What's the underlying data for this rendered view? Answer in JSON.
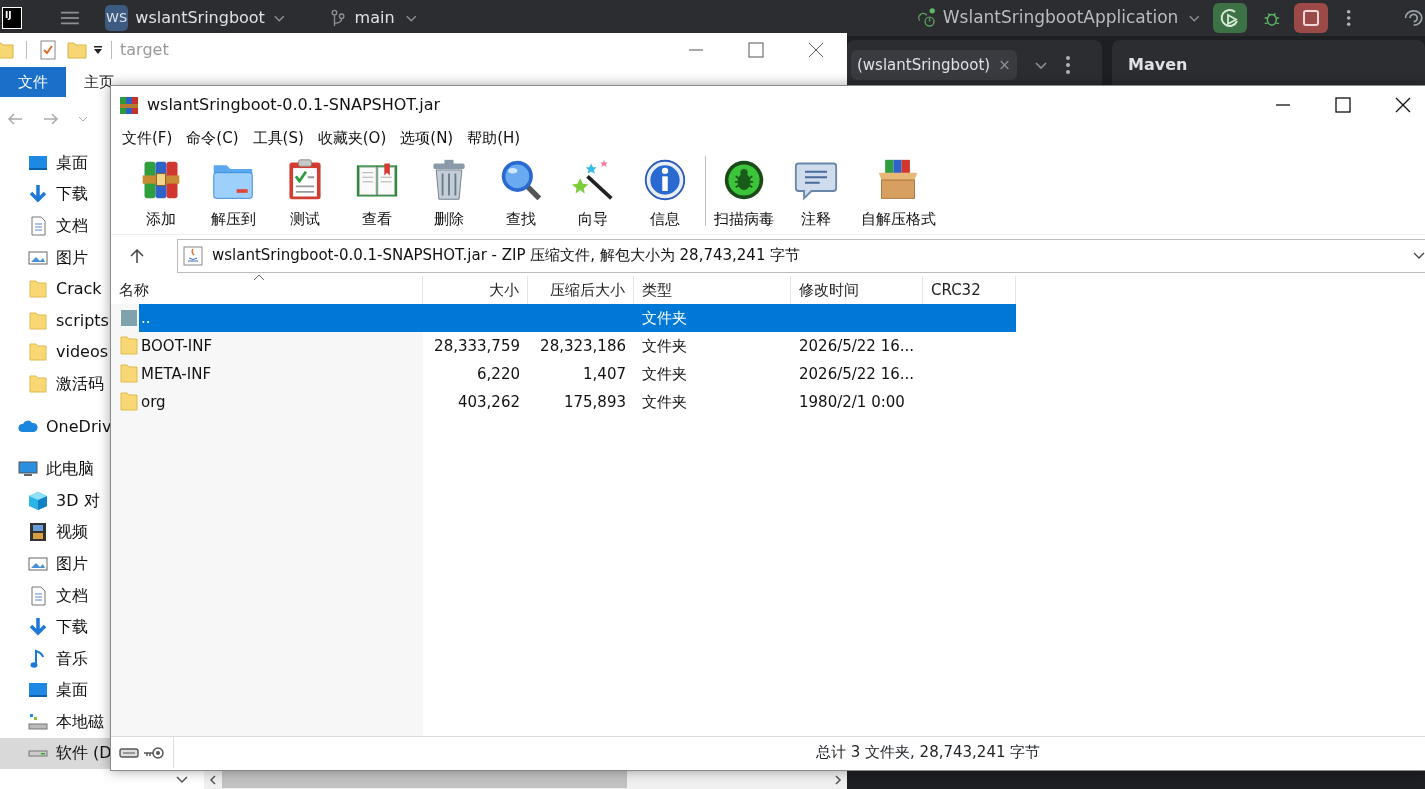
{
  "ide": {
    "logo": "IJ",
    "project_badge": "WS",
    "project": "wslantSringboot",
    "branch": "main",
    "run_config": "WslantSringbootApplication",
    "tab": {
      "label": "(wslantSringboot)",
      "close": "×"
    },
    "panel_title": "Maven"
  },
  "explorer": {
    "title": "target",
    "ribbon_tabs": [
      {
        "label": "文件",
        "selected": true
      },
      {
        "label": "主页",
        "selected": false
      }
    ],
    "quick_access": [
      {
        "label": "桌面",
        "selected": false
      },
      {
        "label": "下载",
        "selected": false
      },
      {
        "label": "文档",
        "selected": false
      },
      {
        "label": "图片",
        "selected": false
      },
      {
        "label": "Crack",
        "selected": false
      },
      {
        "label": "scripts",
        "selected": false
      },
      {
        "label": "videos",
        "selected": false
      },
      {
        "label": "激活码",
        "selected": false
      }
    ],
    "roots": [
      {
        "label": "OneDriv",
        "selected": false
      },
      {
        "label": "此电脑",
        "selected": false,
        "children": [
          {
            "label": "3D 对",
            "selected": false
          },
          {
            "label": "视频",
            "selected": false
          },
          {
            "label": "图片",
            "selected": false
          },
          {
            "label": "文档",
            "selected": false
          },
          {
            "label": "下载",
            "selected": false
          },
          {
            "label": "音乐",
            "selected": false
          },
          {
            "label": "桌面",
            "selected": false
          },
          {
            "label": "本地磁",
            "selected": false
          },
          {
            "label": "软件 (D",
            "selected": true
          }
        ]
      }
    ]
  },
  "winrar": {
    "title": "wslantSringboot-0.0.1-SNAPSHOT.jar",
    "menu": [
      "文件(F)",
      "命令(C)",
      "工具(S)",
      "收藏夹(O)",
      "选项(N)",
      "帮助(H)"
    ],
    "toolbar": [
      {
        "label": "添加"
      },
      {
        "label": "解压到"
      },
      {
        "label": "测试"
      },
      {
        "label": "查看"
      },
      {
        "label": "删除"
      },
      {
        "label": "查找"
      },
      {
        "label": "向导"
      },
      {
        "label": "信息"
      },
      {
        "label": "扫描病毒",
        "separated": true
      },
      {
        "label": "注释"
      },
      {
        "label": "自解压格式"
      }
    ],
    "address": "wslantSringboot-0.0.1-SNAPSHOT.jar - ZIP 压缩文件, 解包大小为 28,743,241 字节",
    "columns": [
      "名称",
      "大小",
      "压缩后大小",
      "类型",
      "修改时间",
      "CRC32"
    ],
    "rows": [
      {
        "kind": "parent",
        "name": "..",
        "type": "文件夹",
        "selected": true
      },
      {
        "kind": "folder",
        "name": "BOOT-INF",
        "size": "28,333,759",
        "packed": "28,323,186",
        "type": "文件夹",
        "modified": "2026/5/22 16...",
        "selected": false
      },
      {
        "kind": "folder",
        "name": "META-INF",
        "size": "6,220",
        "packed": "1,407",
        "type": "文件夹",
        "modified": "2026/5/22 16...",
        "selected": false
      },
      {
        "kind": "folder",
        "name": "org",
        "size": "403,262",
        "packed": "175,893",
        "type": "文件夹",
        "modified": "1980/2/1 0:00",
        "selected": false
      }
    ],
    "status": "总计 3 文件夹, 28,743,241 字节"
  }
}
